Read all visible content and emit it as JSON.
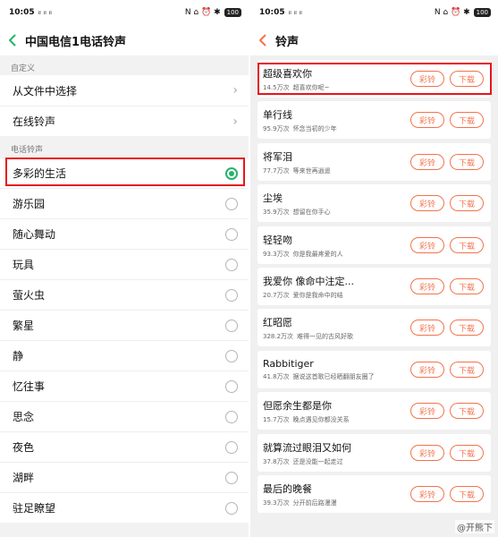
{
  "status_bar": {
    "left_time": "10:05",
    "left_signal": "ᵢₗ ᵢₗ ᵢₗ",
    "left_icons": "N ⌂ ⏰ ✱",
    "left_battery": "100",
    "right_time": "10:05",
    "right_signal": "ᵢₗ ᵢₗ ᵢₗ",
    "right_icons": "N ⌂ ⏰ ✱",
    "right_battery": "100"
  },
  "left": {
    "title": "中国电信1电话铃声",
    "custom_section": "自定义",
    "custom_items": [
      "从文件中选择",
      "在线铃声"
    ],
    "ringtone_section": "电话铃声",
    "ringtones": [
      "多彩的生活",
      "游乐园",
      "随心舞动",
      "玩具",
      "萤火虫",
      "繁星",
      "静",
      "忆往事",
      "思念",
      "夜色",
      "湖畔",
      "驻足瞭望"
    ],
    "selected_index": 0
  },
  "right": {
    "title": "铃声",
    "button_ring": "彩铃",
    "button_download": "下载",
    "songs": [
      {
        "title": "超级喜欢你",
        "plays": "14.5万次",
        "desc": "超喜欢你呢~"
      },
      {
        "title": "单行线",
        "plays": "95.9万次",
        "desc": "怀念当初的少年"
      },
      {
        "title": "将军泪",
        "plays": "77.7万次",
        "desc": "等来世再逍遥"
      },
      {
        "title": "尘埃",
        "plays": "35.9万次",
        "desc": "想留在你手心"
      },
      {
        "title": "轻轻吻",
        "plays": "93.3万次",
        "desc": "你是我最疼爱的人"
      },
      {
        "title": "我爱你 像命中注定...",
        "plays": "20.7万次",
        "desc": "爱你是我命中的结"
      },
      {
        "title": "红昭愿",
        "plays": "328.2万次",
        "desc": "难得一见的古风好歌"
      },
      {
        "title": "Rabbitiger",
        "plays": "41.8万次",
        "desc": "据说这首歌已经晒翻朋友圈了"
      },
      {
        "title": "但愿余生都是你",
        "plays": "15.7万次",
        "desc": "晚点遇见你都没关系"
      },
      {
        "title": "就算流过眼泪又如何",
        "plays": "37.8万次",
        "desc": "还是没能一起走过"
      },
      {
        "title": "最后的晚餐",
        "plays": "39.3万次",
        "desc": "分开前后路漫漫"
      }
    ]
  },
  "colors": {
    "accent_green": "#26b36a",
    "accent_orange": "#f2734d",
    "highlight_red": "#e8141b"
  },
  "watermark": "@开熊下"
}
